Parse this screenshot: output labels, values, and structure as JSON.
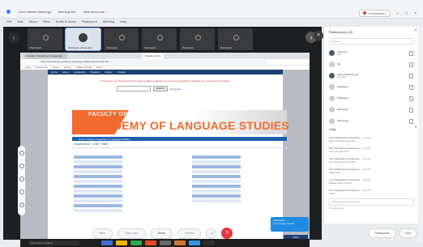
{
  "titlebar": {
    "items": [
      "Cisco Webex Meetings",
      "Meeting info",
      "Hide menu bar ^"
    ],
    "connected": "Connected •"
  },
  "menubar": [
    "File",
    "Edit",
    "Share",
    "View",
    "Audio & Video",
    "Participant",
    "Meeting",
    "Help"
  ],
  "thumbs": [
    {
      "caption": "Participant"
    },
    {
      "caption": "Participant (Presenter)"
    },
    {
      "caption": "Participant"
    },
    {
      "caption": "Participant"
    },
    {
      "caption": "Participant"
    },
    {
      "caption": "Participant"
    }
  ],
  "browser": {
    "tabs": [
      "Faculty of Academy of Language...",
      "Faculty of ALS"
    ],
    "address": "https://www.faculty-academy-language-studies.edu/home/index",
    "bookmarks": [
      "Apps",
      "Bookmarks",
      "Home",
      "Library",
      "Student Portal",
      "News"
    ]
  },
  "site": {
    "nav": [
      "Home",
      "About",
      "Academics",
      "Students",
      "Library",
      "Contact"
    ],
    "alert": "Announcement: Please check the latest updates regarding the upcoming academic schedule and examination timetable.",
    "search_button": "Search",
    "advanced": "Advanced",
    "banner_top": "FACULTY OF",
    "banner_main": "ACADEMY OF LANGUAGE STUDIES",
    "bluebar": "Home  |  Faculty  |  Academy of Language Studies",
    "page_head": "Departments  ·  Units  ·  Staff"
  },
  "notice": {
    "title": "Notification",
    "sub": "New message received"
  },
  "notice_button": "Open",
  "taskbar_search": "Type here to search",
  "controls": [
    "Mute",
    "Stop video",
    "Share",
    "Record"
  ],
  "participants": {
    "title": "Participants (10)",
    "search": "Search",
    "list": [
      {
        "name": "Instructor",
        "role": "Host"
      },
      {
        "name": "Me",
        "role": ""
      },
      {
        "name": "Ahmed Muhammed",
        "role": "Presenter"
      },
      {
        "name": "Participant",
        "role": ""
      },
      {
        "name": "Participant",
        "role": ""
      },
      {
        "name": "Participant",
        "role": ""
      },
      {
        "name": "Participant",
        "role": ""
      },
      {
        "name": "Participant",
        "role": ""
      }
    ]
  },
  "chat": {
    "title": "Chat",
    "messages": [
      {
        "who": "from Participant to Everyone",
        "when": "11:02 AM",
        "txt": "Good morning everyone"
      },
      {
        "who": "from Participant to Everyone",
        "when": "11:03 AM",
        "txt": "Can you hear me?"
      },
      {
        "who": "from Participant to Everyone",
        "when": "11:05 AM",
        "txt": "Yes, the screen is visible"
      },
      {
        "who": "from Participant to Everyone",
        "when": "11:06 AM",
        "txt": "Thank you"
      },
      {
        "who": "from Participant to Everyone",
        "when": "11:08 AM",
        "txt": "Please share the link"
      },
      {
        "who": "from Participant to Everyone",
        "when": "11:09 AM",
        "txt": "Okay"
      }
    ],
    "to": "To: Everyone",
    "input": "Enter chat message here"
  },
  "panel_buttons": [
    "Participants",
    "Chat"
  ]
}
